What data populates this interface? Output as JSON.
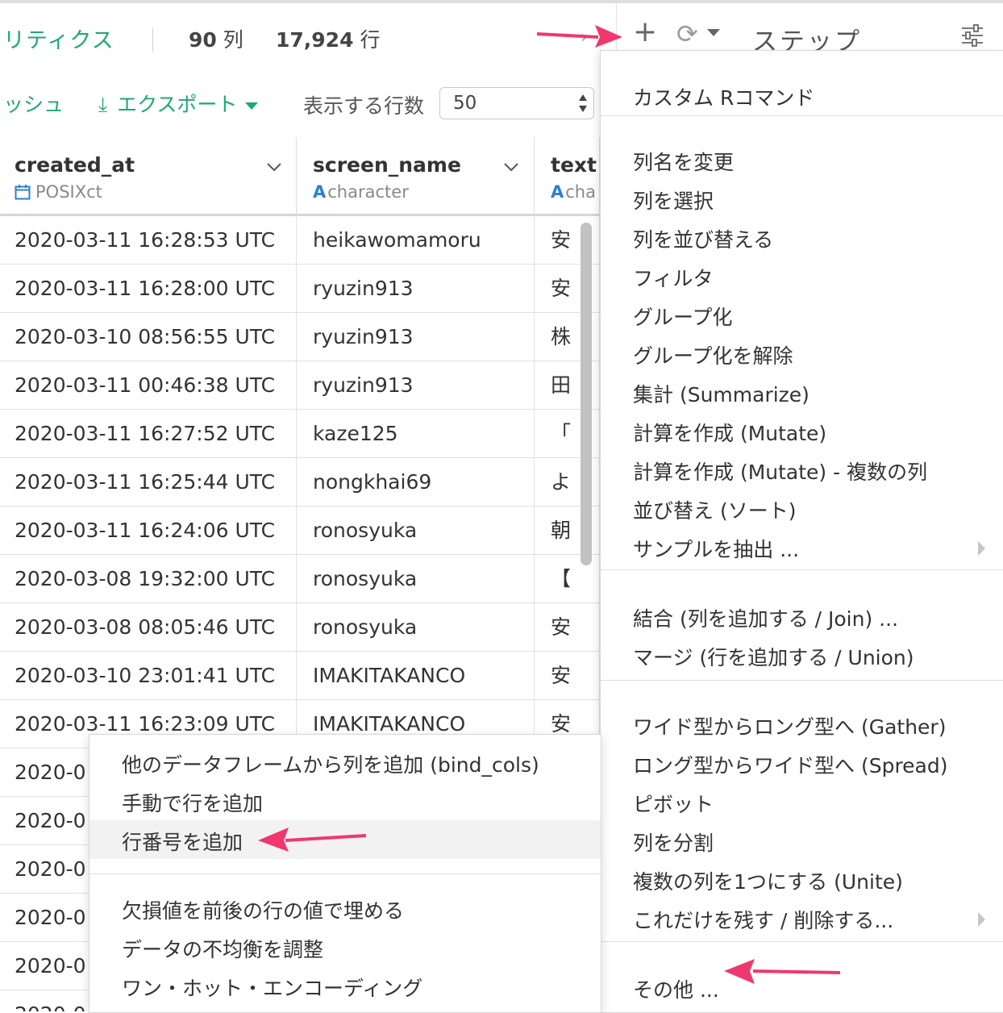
{
  "header": {
    "title": "リティクス",
    "col_count": "90",
    "col_unit": "列",
    "row_count": "17,924",
    "row_unit": "行"
  },
  "step_panel": {
    "title": "ステップ",
    "icons": [
      "plus-icon",
      "refresh-icon",
      "settings-sliders-icon"
    ]
  },
  "toolbar": {
    "refresh_label": "ッシュ",
    "export_label": "エクスポート",
    "rows_label": "表示する行数",
    "rows_value": "50"
  },
  "columns": [
    {
      "name": "created_at",
      "type": "POSIXct",
      "type_icon": "calendar-icon"
    },
    {
      "name": "screen_name",
      "type": "character",
      "type_icon": "A"
    },
    {
      "name": "text",
      "type": "cha",
      "type_icon": "A"
    }
  ],
  "rows": [
    [
      "2020-03-11 16:28:53 UTC",
      "heikawomamoru",
      "安"
    ],
    [
      "2020-03-11 16:28:00 UTC",
      "ryuzin913",
      "安"
    ],
    [
      "2020-03-10 08:56:55 UTC",
      "ryuzin913",
      "株"
    ],
    [
      "2020-03-11 00:46:38 UTC",
      "ryuzin913",
      "田"
    ],
    [
      "2020-03-11 16:27:52 UTC",
      "kaze125",
      "「"
    ],
    [
      "2020-03-11 16:25:44 UTC",
      "nongkhai69",
      "よ"
    ],
    [
      "2020-03-11 16:24:06 UTC",
      "ronosyuka",
      "朝"
    ],
    [
      "2020-03-08 19:32:00 UTC",
      "ronosyuka",
      "【"
    ],
    [
      "2020-03-08 08:05:46 UTC",
      "ronosyuka",
      "安"
    ],
    [
      "2020-03-10 23:01:41 UTC",
      "IMAKITAKANCO",
      "安"
    ],
    [
      "2020-03-11 16:23:09 UTC",
      "IMAKITAKANCO",
      "安"
    ],
    [
      "2020-0",
      "",
      ""
    ],
    [
      "2020-0",
      "",
      ""
    ],
    [
      "2020-0",
      "",
      ""
    ],
    [
      "2020-0",
      "",
      ""
    ],
    [
      "2020-0",
      "",
      ""
    ],
    [
      "2020-0",
      "",
      ""
    ]
  ],
  "menu": {
    "groups": [
      [
        "カスタム Rコマンド"
      ],
      [
        "列名を変更",
        "列を選択",
        "列を並び替える",
        "フィルタ",
        "グループ化",
        "グループ化を解除",
        "集計 (Summarize)",
        "計算を作成 (Mutate)",
        "計算を作成 (Mutate) - 複数の列",
        "並び替え (ソート)",
        "サンプルを抽出 ..."
      ],
      [
        "結合 (列を追加する / Join) ...",
        "マージ (行を追加する / Union)"
      ],
      [
        "ワイド型からロング型へ (Gather)",
        "ロング型からワイド型へ (Spread)",
        "ピボット",
        "列を分割",
        "複数の列を1つにする (Unite)",
        "これだけを残す / 削除する..."
      ],
      [
        "その他 ..."
      ]
    ]
  },
  "submenu": {
    "groups": [
      [
        "他のデータフレームから列を追加 (bind_cols)",
        "手動で行を追加",
        "行番号を追加"
      ],
      [
        "欠損値を前後の行の値で埋める",
        "データの不均衡を調整",
        "ワン・ホット・エンコーディング"
      ]
    ],
    "highlighted": "行番号を追加"
  },
  "colors": {
    "accent": "#1ea875",
    "type_icon": "#2a7fd4",
    "annotation_arrow": "#f0376e"
  }
}
